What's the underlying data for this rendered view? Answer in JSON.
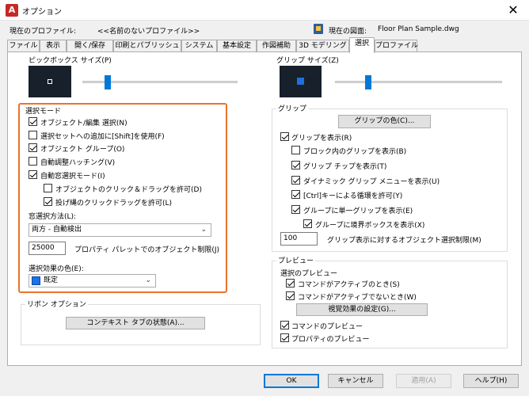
{
  "window": {
    "title": "オプション",
    "close_glyph": "✕"
  },
  "profile": {
    "label": "現在のプロファイル:",
    "value": "<<名前のないプロファイル>>"
  },
  "drawing": {
    "label": "現在の図面:",
    "value": "Floor Plan Sample.dwg"
  },
  "tabs": [
    {
      "label": "ファイル"
    },
    {
      "label": "表示"
    },
    {
      "label": "開く/保存"
    },
    {
      "label": "印刷とパブリッシュ"
    },
    {
      "label": "システム"
    },
    {
      "label": "基本設定"
    },
    {
      "label": "作図補助"
    },
    {
      "label": "3D モデリング"
    },
    {
      "label": "選択"
    },
    {
      "label": "プロファイル"
    }
  ],
  "pickbox": {
    "title": "ピックボックス サイズ(P)",
    "level": 0.18
  },
  "grip_size": {
    "title": "グリップ サイズ(Z)",
    "level": 0.38
  },
  "selection_mode": {
    "title": "選択モード",
    "noun_verb": "オブジェクト/編集 選択(N)",
    "shift_add": "選択セットへの追加に[Shift]を使用(F)",
    "object_group": "オブジェクト グループ(O)",
    "assoc_hatch": "自動調整ハッチング(V)",
    "implied_window": "自動窓選択モード(I)",
    "click_drag": "オブジェクトのクリック＆ドラッグを許可(D)",
    "lasso": "投げ縄のクリックドラッグを許可(L)",
    "window_method_label": "窓選択方法(L):",
    "window_method_value": "両方 - 自動検出",
    "palette_limit_value": "25000",
    "palette_limit_label": "プロパティ パレットでのオブジェクト制限(J)",
    "effect_color_label": "選択効果の色(E):",
    "effect_color_value": "既定",
    "effect_color_hex": "#1a73e8"
  },
  "ribbon": {
    "title": "リボン オプション",
    "contextual_button": "コンテキスト タブの状態(A)..."
  },
  "grips": {
    "title": "グリップ",
    "color_button": "グリップの色(C)...",
    "show_grips": "グリップを表示(R)",
    "grips_in_blocks": "ブロック内のグリップを表示(B)",
    "grip_tips": "グリップ チップを表示(T)",
    "dynamic_menu": "ダイナミック グリップ メニューを表示(U)",
    "ctrl_cycle": "[Ctrl]キーによる循環を許可(Y)",
    "single_grip_group": "グループに単一グリップを表示(E)",
    "bbox_group": "グループに境界ボックスを表示(X)",
    "object_limit_value": "100",
    "object_limit_label": "グリップ表示に対するオブジェクト選択制限(M)"
  },
  "preview": {
    "title": "プレビュー",
    "selection_preview": "選択のプレビュー",
    "cmd_active": "コマンドがアクティブのとき(S)",
    "cmd_inactive": "コマンドがアクティブでないとき(W)",
    "visual_effects_button": "視覚効果の設定(G)...",
    "command_preview": "コマンドのプレビュー",
    "property_preview": "プロパティのプレビュー"
  },
  "footer": {
    "ok": "OK",
    "cancel": "キャンセル",
    "apply": "適用(A)",
    "help": "ヘルプ(H)"
  }
}
